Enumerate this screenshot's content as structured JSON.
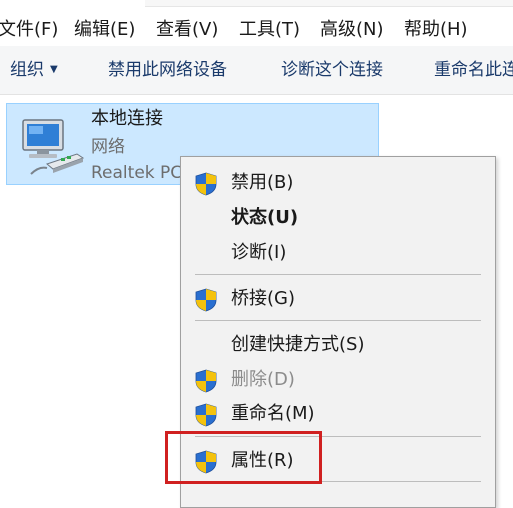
{
  "menubar": {
    "items": [
      "文件(F)",
      "编辑(E)",
      "查看(V)",
      "工具(T)",
      "高级(N)",
      "帮助(H)"
    ]
  },
  "commandbar": {
    "organize": "组织",
    "disable_device": "禁用此网络设备",
    "diagnose": "诊断这个连接",
    "rename": "重命名此连"
  },
  "connection": {
    "name": "本地连接",
    "status": "网络",
    "device": "Realtek PCIe GbE Family Controller"
  },
  "context_menu": {
    "items": [
      {
        "label": "禁用(B)",
        "icon": "uac-shield-icon"
      },
      {
        "label": "状态(U)",
        "bold": true
      },
      {
        "label": "诊断(I)"
      },
      {
        "label": "桥接(G)",
        "icon": "uac-shield-icon"
      },
      {
        "label": "创建快捷方式(S)"
      },
      {
        "label": "删除(D)",
        "icon": "uac-shield-icon",
        "disabled": true
      },
      {
        "label": "重命名(M)",
        "icon": "uac-shield-icon"
      },
      {
        "label": "属性(R)",
        "icon": "uac-shield-icon",
        "highlighted": true
      }
    ]
  },
  "colors": {
    "selection": "#cce8ff",
    "selection_border": "#99d1ff",
    "highlight_box": "#d02020",
    "menu_bg": "#f2f2f2",
    "command_text": "#1a3a6b"
  }
}
